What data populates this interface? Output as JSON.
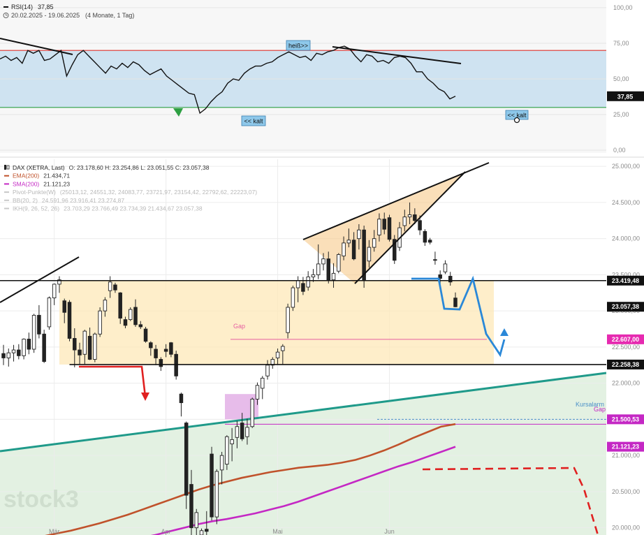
{
  "header": {
    "rsi_label": "RSI(14)",
    "rsi_value": "37,85",
    "period": "20.02.2025 - 19.06.2025",
    "range": "(4 Monate, 1 Tag)"
  },
  "legend": [
    {
      "name": "DAX (XETRA, Last)",
      "text": "O: 23.178,60  H: 23.254,86  L: 23.051,55  C: 23.057,38",
      "color": "#222222"
    },
    {
      "name": "EMA(200)",
      "text": "21.434,71",
      "color": "#c0522b"
    },
    {
      "name": "SMA(200)",
      "text": "21.121,23",
      "color": "#c428c4"
    },
    {
      "name": "Pivot-Punkte(W)",
      "text": "(25013,12, 24551,32, 24083,77, 23721,97, 23154,42, 22792,62, 22223,07)",
      "color": "#c8c8c8"
    },
    {
      "name": "BB(20, 2)",
      "text": "24.591,96  23.916,41  23.274,87",
      "color": "#c8c8c8"
    },
    {
      "name": "IKH(9, 26, 52, 26)",
      "text": "23.703,29  23.766,49  23.734,39  21.434,67  23.057,38",
      "color": "#c8c8c8"
    }
  ],
  "annotations": {
    "hot": "heiß>>",
    "cold_upper": "<< kalt",
    "cold_right": "<< kalt",
    "gap1": "Gap",
    "gap2": "Gap",
    "kursalarm": "Kursalarm",
    "watermark": "stock3"
  },
  "colors": {
    "up_candle": "#ffffff",
    "down_candle": "#222222",
    "ema": "#c0522b",
    "sma": "#c428c4",
    "channel_line": "#1f9a8a",
    "range_box": "#fde8b8",
    "triangle_fill": "#f7c98a",
    "projection": "#2a88d8",
    "rsi_band": "#cfe3f1"
  },
  "chart_data": [
    {
      "type": "line",
      "title": "RSI(14)",
      "ylim": [
        0,
        100
      ],
      "yticks": [
        "100,00",
        "75,00",
        "50,00",
        "25,00",
        "0,00"
      ],
      "overbought": 70,
      "oversold": 30,
      "current_label": "37,85",
      "series": [
        {
          "name": "RSI(14)",
          "values": [
            64,
            66,
            63,
            65,
            61,
            70,
            68,
            70,
            63,
            64,
            67,
            70,
            52,
            60,
            67,
            70,
            66,
            62,
            58,
            54,
            59,
            57,
            61,
            58,
            62,
            60,
            56,
            53,
            55,
            57,
            52,
            49,
            46,
            43,
            40,
            39,
            26,
            29,
            34,
            38,
            41,
            47,
            50,
            49,
            54,
            57,
            59,
            59,
            61,
            62,
            65,
            67,
            69,
            67,
            65,
            66,
            63,
            68,
            67,
            69,
            70,
            72,
            73,
            71,
            66,
            62,
            67,
            66,
            62,
            63,
            61,
            65,
            66,
            65,
            61,
            55,
            55,
            50,
            47,
            43,
            41,
            36,
            37.85
          ]
        }
      ]
    },
    {
      "type": "candlestick",
      "title": "DAX (XETRA, Last)",
      "ylim": [
        19900,
        25050
      ],
      "yticks": [
        "25.000,00",
        "24.500,00",
        "24.000,00",
        "23.500,00",
        "23.000,00",
        "22.500,00",
        "22.000,00",
        "21.500,00",
        "21.000,00",
        "20.500,00",
        "20.000,00"
      ],
      "x_labels": [
        "Mär",
        "Apr",
        "Mai",
        "Jun"
      ],
      "price_labels": [
        "23.419,48",
        "23.057,38",
        "22.607,00",
        "22.258,38",
        "21.500,53",
        "21.121,23"
      ],
      "candles": [
        {
          "o": 22410,
          "h": 22530,
          "l": 22250,
          "c": 22350
        },
        {
          "o": 22350,
          "h": 22480,
          "l": 22230,
          "c": 22420
        },
        {
          "o": 22420,
          "h": 22530,
          "l": 22300,
          "c": 22460
        },
        {
          "o": 22460,
          "h": 22540,
          "l": 22330,
          "c": 22380
        },
        {
          "o": 22380,
          "h": 22620,
          "l": 22330,
          "c": 22610
        },
        {
          "o": 22610,
          "h": 22700,
          "l": 22400,
          "c": 22470
        },
        {
          "o": 22470,
          "h": 22960,
          "l": 22420,
          "c": 22940
        },
        {
          "o": 22940,
          "h": 23080,
          "l": 22620,
          "c": 22680
        },
        {
          "o": 22680,
          "h": 22740,
          "l": 22280,
          "c": 22300
        },
        {
          "o": 22780,
          "h": 23200,
          "l": 22740,
          "c": 23180
        },
        {
          "o": 23180,
          "h": 23380,
          "l": 23080,
          "c": 23370
        },
        {
          "o": 23370,
          "h": 23480,
          "l": 23250,
          "c": 23430
        },
        {
          "o": 23140,
          "h": 23170,
          "l": 22830,
          "c": 22980
        },
        {
          "o": 23120,
          "h": 23150,
          "l": 22580,
          "c": 22620
        },
        {
          "o": 22620,
          "h": 22760,
          "l": 22220,
          "c": 22460
        },
        {
          "o": 22460,
          "h": 22560,
          "l": 22260,
          "c": 22390
        },
        {
          "o": 22400,
          "h": 22740,
          "l": 22260,
          "c": 22720
        },
        {
          "o": 22650,
          "h": 22770,
          "l": 22320,
          "c": 22330
        },
        {
          "o": 22330,
          "h": 22700,
          "l": 22290,
          "c": 22680
        },
        {
          "o": 22680,
          "h": 23050,
          "l": 22640,
          "c": 23000
        },
        {
          "o": 23000,
          "h": 23190,
          "l": 22920,
          "c": 23150
        },
        {
          "o": 23280,
          "h": 23480,
          "l": 23180,
          "c": 23400
        },
        {
          "o": 23360,
          "h": 23390,
          "l": 23250,
          "c": 23290
        },
        {
          "o": 23250,
          "h": 23260,
          "l": 22820,
          "c": 22900
        },
        {
          "o": 22880,
          "h": 22920,
          "l": 22760,
          "c": 22800
        },
        {
          "o": 22880,
          "h": 23050,
          "l": 22860,
          "c": 23020
        },
        {
          "o": 23050,
          "h": 23160,
          "l": 22780,
          "c": 22810
        },
        {
          "o": 22810,
          "h": 22860,
          "l": 22750,
          "c": 22780
        },
        {
          "o": 22750,
          "h": 22780,
          "l": 22560,
          "c": 22580
        },
        {
          "o": 22560,
          "h": 22580,
          "l": 22380,
          "c": 22490
        },
        {
          "o": 22470,
          "h": 22530,
          "l": 22250,
          "c": 22350
        },
        {
          "o": 22330,
          "h": 22360,
          "l": 22170,
          "c": 22230
        },
        {
          "o": 22470,
          "h": 22540,
          "l": 22360,
          "c": 22440
        },
        {
          "o": 22560,
          "h": 22570,
          "l": 22360,
          "c": 22400
        },
        {
          "o": 22400,
          "h": 22450,
          "l": 22050,
          "c": 22100
        },
        {
          "o": 21850,
          "h": 21870,
          "l": 21540,
          "c": 21730
        },
        {
          "o": 21450,
          "h": 21470,
          "l": 20260,
          "c": 20450
        },
        {
          "o": 20600,
          "h": 20800,
          "l": 19900,
          "c": 20000
        },
        {
          "o": 20000,
          "h": 20260,
          "l": 19880,
          "c": 20210
        },
        {
          "o": 19900,
          "h": 19990,
          "l": 19820,
          "c": 19960
        },
        {
          "o": 19980,
          "h": 20230,
          "l": 19900,
          "c": 19950
        },
        {
          "o": 21020,
          "h": 21120,
          "l": 20100,
          "c": 20150
        },
        {
          "o": 20150,
          "h": 20810,
          "l": 20050,
          "c": 20780
        },
        {
          "o": 20800,
          "h": 21050,
          "l": 20600,
          "c": 21000
        },
        {
          "o": 20880,
          "h": 21280,
          "l": 20800,
          "c": 21260
        },
        {
          "o": 21160,
          "h": 21380,
          "l": 20920,
          "c": 21220
        },
        {
          "o": 21250,
          "h": 21480,
          "l": 21100,
          "c": 21400
        },
        {
          "o": 21450,
          "h": 21590,
          "l": 21200,
          "c": 21230
        },
        {
          "o": 21260,
          "h": 21510,
          "l": 21150,
          "c": 21390
        },
        {
          "o": 21400,
          "h": 21800,
          "l": 21380,
          "c": 21780
        },
        {
          "o": 21780,
          "h": 22010,
          "l": 21700,
          "c": 21970
        },
        {
          "o": 21930,
          "h": 22100,
          "l": 21780,
          "c": 22070
        },
        {
          "o": 22100,
          "h": 22320,
          "l": 22050,
          "c": 22250
        },
        {
          "o": 22250,
          "h": 22360,
          "l": 22200,
          "c": 22330
        },
        {
          "o": 22350,
          "h": 22480,
          "l": 22260,
          "c": 22430
        },
        {
          "o": 22450,
          "h": 22540,
          "l": 22260,
          "c": 22510
        },
        {
          "o": 22700,
          "h": 23100,
          "l": 22620,
          "c": 23050
        },
        {
          "o": 23050,
          "h": 23350,
          "l": 23000,
          "c": 23320
        },
        {
          "o": 23320,
          "h": 23480,
          "l": 23120,
          "c": 23420
        },
        {
          "o": 23380,
          "h": 23470,
          "l": 23220,
          "c": 23270
        },
        {
          "o": 23330,
          "h": 23550,
          "l": 23280,
          "c": 23470
        },
        {
          "o": 23470,
          "h": 23580,
          "l": 23400,
          "c": 23500
        },
        {
          "o": 23500,
          "h": 23920,
          "l": 23440,
          "c": 23650
        },
        {
          "o": 23650,
          "h": 23800,
          "l": 23560,
          "c": 23720
        },
        {
          "o": 23720,
          "h": 23820,
          "l": 23380,
          "c": 23430
        },
        {
          "o": 23430,
          "h": 23660,
          "l": 23320,
          "c": 23520
        },
        {
          "o": 23550,
          "h": 23800,
          "l": 23520,
          "c": 23780
        },
        {
          "o": 23760,
          "h": 24030,
          "l": 23700,
          "c": 23940
        },
        {
          "o": 23940,
          "h": 24140,
          "l": 23880,
          "c": 23980
        },
        {
          "o": 23980,
          "h": 24090,
          "l": 23700,
          "c": 23720
        },
        {
          "o": 24000,
          "h": 24200,
          "l": 23850,
          "c": 24120
        },
        {
          "o": 24120,
          "h": 24180,
          "l": 23320,
          "c": 23430
        },
        {
          "o": 23690,
          "h": 23980,
          "l": 23600,
          "c": 23880
        },
        {
          "o": 23880,
          "h": 24120,
          "l": 23820,
          "c": 24000
        },
        {
          "o": 24050,
          "h": 24350,
          "l": 23960,
          "c": 24270
        },
        {
          "o": 24270,
          "h": 24360,
          "l": 24060,
          "c": 24130
        },
        {
          "o": 24290,
          "h": 24330,
          "l": 23960,
          "c": 23990
        },
        {
          "o": 23990,
          "h": 24050,
          "l": 23650,
          "c": 23700
        },
        {
          "o": 23880,
          "h": 24230,
          "l": 23830,
          "c": 24150
        },
        {
          "o": 24180,
          "h": 24400,
          "l": 24100,
          "c": 24300
        },
        {
          "o": 24300,
          "h": 24500,
          "l": 24200,
          "c": 24330
        },
        {
          "o": 24330,
          "h": 24420,
          "l": 24200,
          "c": 24250
        },
        {
          "o": 24250,
          "h": 24320,
          "l": 24050,
          "c": 24120
        },
        {
          "o": 24100,
          "h": 24130,
          "l": 23900,
          "c": 23950
        },
        {
          "o": 23980,
          "h": 24010,
          "l": 23920,
          "c": 23950
        },
        {
          "o": 23710,
          "h": 23820,
          "l": 23640,
          "c": 23700
        },
        {
          "o": 23500,
          "h": 23560,
          "l": 23380,
          "c": 23450
        },
        {
          "o": 23540,
          "h": 23700,
          "l": 23510,
          "c": 23650
        },
        {
          "o": 23480,
          "h": 23540,
          "l": 23350,
          "c": 23400
        },
        {
          "o": 23178.6,
          "h": 23254.86,
          "l": 23051.55,
          "c": 23057.38
        }
      ],
      "ema200": [
        19840,
        19880,
        19920,
        19960,
        20010,
        20060,
        20120,
        20180,
        20250,
        20320,
        20390,
        20460,
        20530,
        20590,
        20640,
        20690,
        20730,
        20770,
        20800,
        20830,
        20850,
        20870,
        20900,
        20940,
        21000,
        21070,
        21150,
        21240,
        21320,
        21400,
        21434.71
      ],
      "sma200": [
        19700,
        19740,
        19780,
        19810,
        19860,
        19900,
        19950,
        20000,
        20050,
        20090,
        20120,
        20160,
        20200,
        20250,
        20300,
        20360,
        20430,
        20500,
        20570,
        20640,
        20710,
        20780,
        20850,
        20910,
        20980,
        21050,
        21121.23
      ],
      "levels": {
        "range_top": 23419.48,
        "range_bottom": 22258.38,
        "gap_upper": 22607.0,
        "gap_lower": 21500.53,
        "kursalarm": 21500.53
      }
    }
  ]
}
